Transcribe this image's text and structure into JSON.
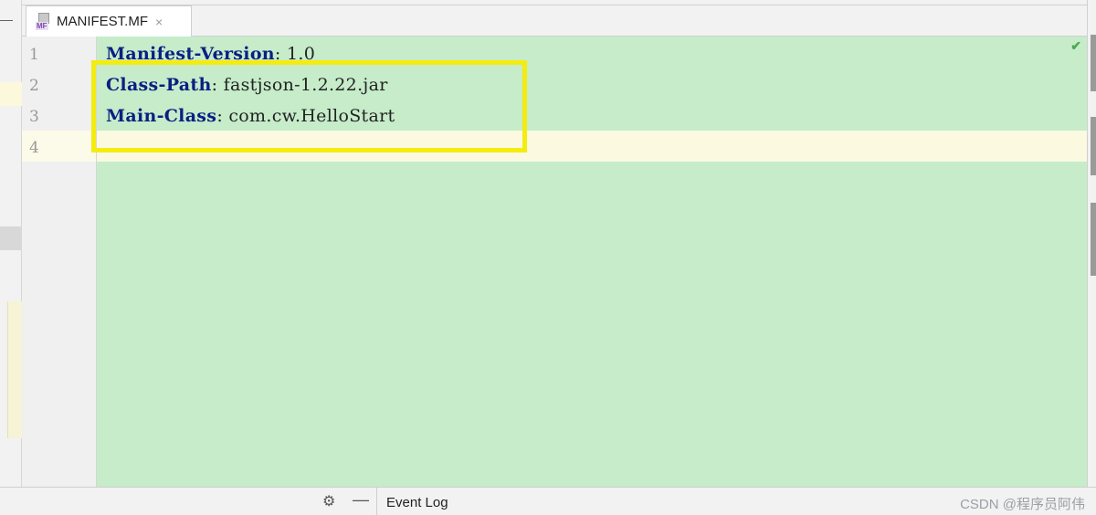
{
  "tab": {
    "icon_badge": "MF",
    "label": "MANIFEST.MF",
    "close": "×"
  },
  "editor": {
    "line_numbers": [
      "1",
      "2",
      "3",
      "4"
    ],
    "lines": [
      {
        "key": "Manifest-Version",
        "sep": ": ",
        "value": "1.0"
      },
      {
        "key": "Class-Path",
        "sep": ": ",
        "value": "fastjson-1.2.22.jar"
      },
      {
        "key": "Main-Class",
        "sep": ": ",
        "value": "com.cw.HelloStart"
      },
      {
        "key": "",
        "sep": "",
        "value": ""
      }
    ],
    "background_color": "#c6ecca",
    "current_line_color": "#fbf9e0",
    "key_color": "#0a1f82"
  },
  "highlight": {
    "color": "#f5ec0f"
  },
  "statusbar": {
    "event_log": "Event Log",
    "watermark": "CSDN @程序员阿伟"
  },
  "icons": {
    "hide": "—",
    "check": "✔",
    "gear": "⚙",
    "minus": "—"
  }
}
